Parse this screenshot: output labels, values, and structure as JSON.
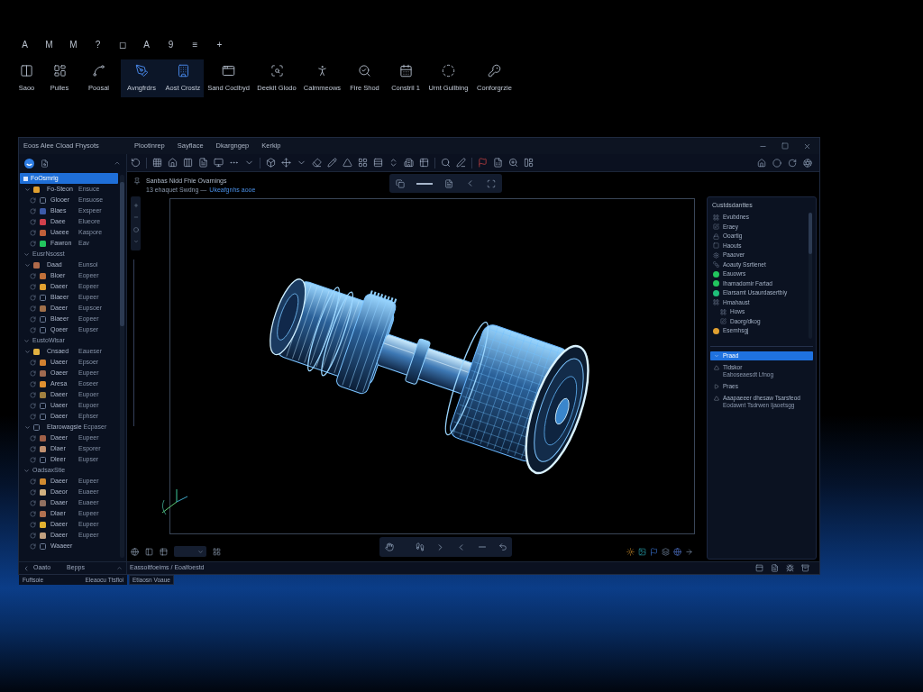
{
  "quick_bar": [
    "A",
    "M",
    "M",
    "?",
    "◻",
    "A",
    "9",
    "≡",
    "+"
  ],
  "ribbon": [
    {
      "label": "Saoo",
      "selected": false
    },
    {
      "label": "Pulles",
      "selected": false
    },
    {
      "label": "Poosal",
      "selected": false
    },
    {
      "label": "Avngfrdrs",
      "selected": true
    },
    {
      "label": "Aost Crostz",
      "selected": true
    },
    {
      "label": "Sand Coclbyd",
      "selected": false
    },
    {
      "label": "Deekit Glodo",
      "selected": false
    },
    {
      "label": "Calmmeows",
      "selected": false
    },
    {
      "label": "Fire Shod",
      "selected": false
    },
    {
      "label": "Constril 1",
      "selected": false
    },
    {
      "label": "Urnt Gullbing",
      "selected": false
    },
    {
      "label": "Conforgrzie",
      "selected": false
    }
  ],
  "window": {
    "title": "Eoos Alee Cload Fhysots",
    "menu": [
      "Plootinrep",
      "Sayflace",
      "Dkargngep",
      "Kerkip"
    ]
  },
  "tree": [
    {
      "label": "FoOsmrig",
      "selected": true,
      "children": [
        {
          "label": "Fo-Steon",
          "value": "Ensuce",
          "color": "#e0a030",
          "expanded": true,
          "children": [
            {
              "label": "Glooer",
              "value": "Ensuose"
            },
            {
              "label": "Blaes",
              "value": "Exspeer",
              "color": "#3c5aa8"
            },
            {
              "label": "Daee",
              "value": "Elueore",
              "color": "#d0404c"
            },
            {
              "label": "Uaeee",
              "value": "Kaspore",
              "color": "#c0603a"
            },
            {
              "label": "Fawron",
              "value": "Eav",
              "color": "#22c55e"
            }
          ]
        }
      ]
    },
    {
      "label": "EusrNsosst",
      "selected": false,
      "expanded": true,
      "children": [
        {
          "label": "Daad",
          "value": "Eunsol",
          "color": "#b06a4a",
          "expanded": true,
          "children": [
            {
              "label": "Bloer",
              "value": "Eopeer",
              "color": "#c0703a"
            },
            {
              "label": "Daeer",
              "value": "Eopeer",
              "color": "#e0a030"
            },
            {
              "label": "Blaeer",
              "value": "Eupeer"
            },
            {
              "label": "Daeer",
              "value": "Eupsoer",
              "color": "#a0704a"
            },
            {
              "label": "Blaeer",
              "value": "Eopeer"
            },
            {
              "label": "Qoeer",
              "value": "Eupser"
            }
          ]
        }
      ]
    },
    {
      "label": "EustoWlsar",
      "selected": false,
      "expanded": true,
      "children": [
        {
          "label": "Cnsaed",
          "value": "Eaueser",
          "color": "#e0b040",
          "expanded": true,
          "children": [
            {
              "label": "Uaeer",
              "value": "Epsoer",
              "color": "#d08030"
            },
            {
              "label": "Oaeer",
              "value": "Eupeer",
              "color": "#a06a50"
            },
            {
              "label": "Aresa",
              "value": "Eoseer",
              "color": "#e09030"
            },
            {
              "label": "Daeer",
              "value": "Eupoer",
              "color": "#a08040"
            },
            {
              "label": "Uaeer",
              "value": "Eupoer"
            },
            {
              "label": "Daeer",
              "value": "Ephser"
            }
          ]
        },
        {
          "label": "Etarowagsie",
          "value": "Ecpaser",
          "expanded": true,
          "children": [
            {
              "label": "Daeer",
              "value": "Eupeer",
              "color": "#a06048"
            },
            {
              "label": "Dlaer",
              "value": "Esporer",
              "color": "#c09070"
            },
            {
              "label": "Dleer",
              "value": "Eupser"
            }
          ]
        }
      ]
    },
    {
      "label": "OadsaxStie",
      "selected": false,
      "expanded": true,
      "children": [
        {
          "label": "Daeer",
          "value": "Eupeer",
          "color": "#d08a30"
        },
        {
          "label": "Daeor",
          "value": "Euaeer",
          "color": "#d0b080"
        },
        {
          "label": "Daaer",
          "value": "Euaeer",
          "color": "#907060"
        },
        {
          "label": "Dlaer",
          "value": "Eupeer",
          "color": "#b07050"
        },
        {
          "label": "Daeer",
          "value": "Eupeer",
          "color": "#e0b030"
        },
        {
          "label": "Daeer",
          "value": "Eupeer",
          "color": "#c0a080"
        },
        {
          "label": "Waaeer"
        }
      ]
    }
  ],
  "tree_footer": {
    "back": "Oaato",
    "tab": "Bepps"
  },
  "viewport": {
    "title": "Sanbas Nidd Fhie Ovarnings",
    "subtitle": "13 ehaquet Swdng —",
    "link": "Ukeafgnhs aooe"
  },
  "properties": {
    "title": "Custdsdanttes",
    "items": [
      {
        "label": "Evubdnes"
      },
      {
        "label": "Eraey"
      },
      {
        "label": "Ooartig"
      },
      {
        "label": "Haouts"
      },
      {
        "label": "Paaover"
      },
      {
        "label": "Aoauty Ssrtienet"
      },
      {
        "label": "Eauowrs",
        "color": "#22c55e"
      },
      {
        "label": "Ihamadomir Fartad",
        "color": "#22c55e"
      },
      {
        "label": "Elarsamt Usaurdasertbiy",
        "color": "#1fbf7a"
      },
      {
        "label": "Hmahaust",
        "children": [
          {
            "label": "Hows"
          },
          {
            "label": "Daorg/dkog"
          }
        ]
      },
      {
        "label": "Esemhsgj",
        "color": "#e0a030"
      }
    ],
    "outline": [
      {
        "label": "Praad",
        "selected": true
      },
      {
        "label": "Tldskor",
        "detail": "Eaboseaesdt Lfnog",
        "selected": false
      },
      {
        "label": "Praes",
        "selected": false
      },
      {
        "label": "Aaapaeeer dhesaw Tsarsfeod",
        "detail": "Eodawnt Tsdrwen Ijaoetsgg",
        "selected": false
      }
    ]
  },
  "status_bar": {
    "text": "Eassoitfoeims / Eoalfoestd"
  },
  "bottom_strip": [
    "Fuftsoie",
    "Eleaocu Ttsfloi",
    "Etiaosn Voaue"
  ]
}
